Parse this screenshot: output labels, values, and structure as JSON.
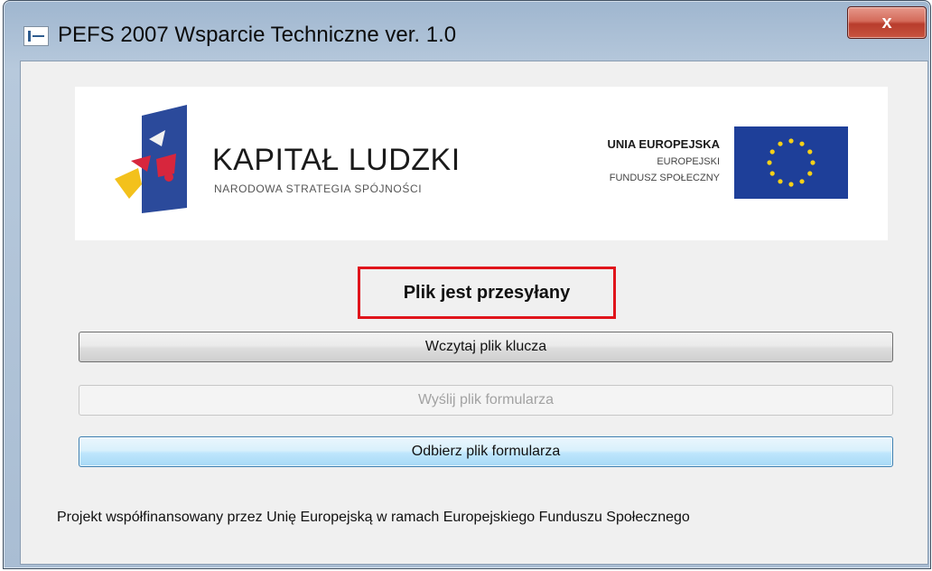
{
  "window": {
    "title": "PEFS 2007 Wsparcie Techniczne  ver. 1.0",
    "close_label": "x"
  },
  "banner": {
    "kapital_title": "KAPITAŁ LUDZKI",
    "kapital_subtitle": "NARODOWA STRATEGIA SPÓJNOŚCI",
    "eu_line1": "UNIA EUROPEJSKA",
    "eu_line2": "EUROPEJSKI",
    "eu_line3": "FUNDUSZ SPOŁECZNY"
  },
  "status": {
    "message": "Plik jest przesyłany",
    "highlight_color": "#e0141b"
  },
  "buttons": {
    "load_key": "Wczytaj plik klucza",
    "send_form": "Wyślij plik formularza",
    "receive_form": "Odbierz plik formularza"
  },
  "footer": {
    "text": "Projekt współfinansowany przez Unię Europejską w ramach Europejskiego Funduszu Społecznego"
  },
  "icons": {
    "app": "app-icon",
    "close": "close-icon",
    "kapital_logo": "kapital-ludzki-logo",
    "eu_flag": "eu-flag-icon"
  }
}
